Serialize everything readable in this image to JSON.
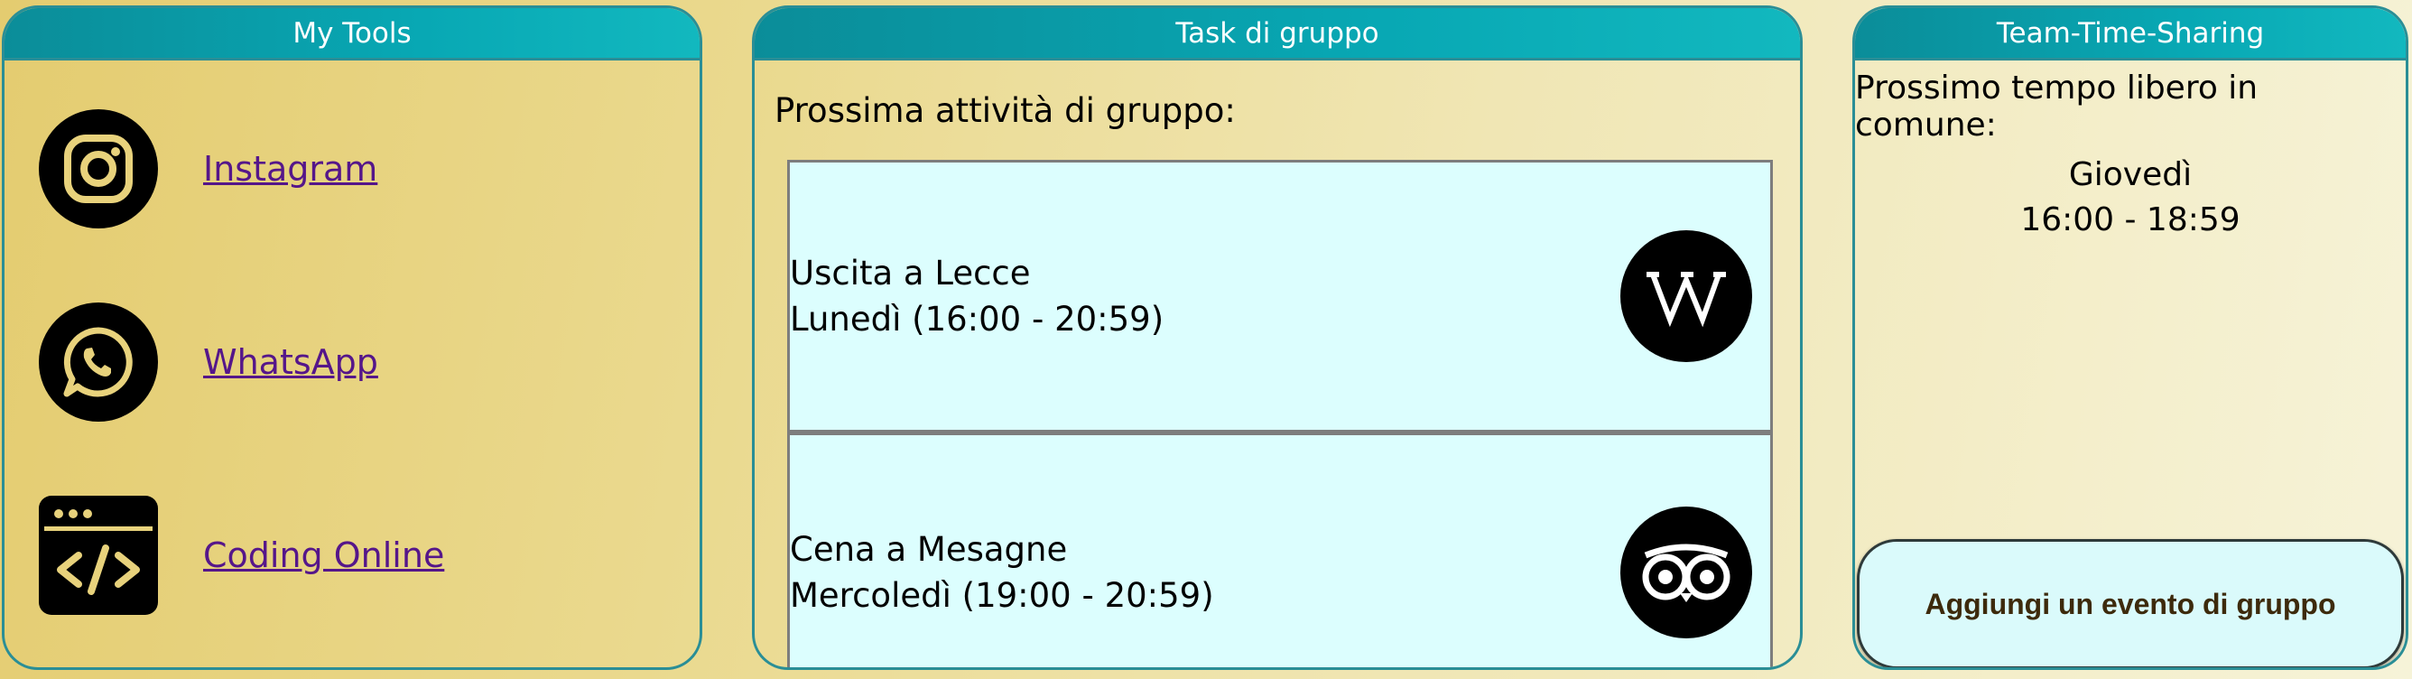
{
  "tools": {
    "title": "My Tools",
    "items": [
      {
        "label": "Instagram",
        "icon": "instagram-icon"
      },
      {
        "label": "WhatsApp",
        "icon": "whatsapp-icon"
      },
      {
        "label": "Coding Online",
        "icon": "code-icon"
      }
    ]
  },
  "tasks": {
    "title": "Task di gruppo",
    "heading": "Prossima attività di gruppo:",
    "items": [
      {
        "name": "Uscita a Lecce",
        "when": "Lunedì (16:00 - 20:59)",
        "icon": "wikipedia-icon"
      },
      {
        "name": "Cena a Mesagne",
        "when": "Mercoledì (19:00 - 20:59)",
        "icon": "tripadvisor-icon"
      }
    ]
  },
  "tts": {
    "title": "Team-Time-Sharing",
    "intro": "Prossimo tempo libero in comune:",
    "day": "Giovedì",
    "time": "16:00 - 18:59",
    "button_label": "Aggiungi un evento di gruppo"
  },
  "colors": {
    "header": "#0b9aa6",
    "link": "#55168a",
    "card": "#dcfefe",
    "icon_accent": "#e8d27c"
  }
}
